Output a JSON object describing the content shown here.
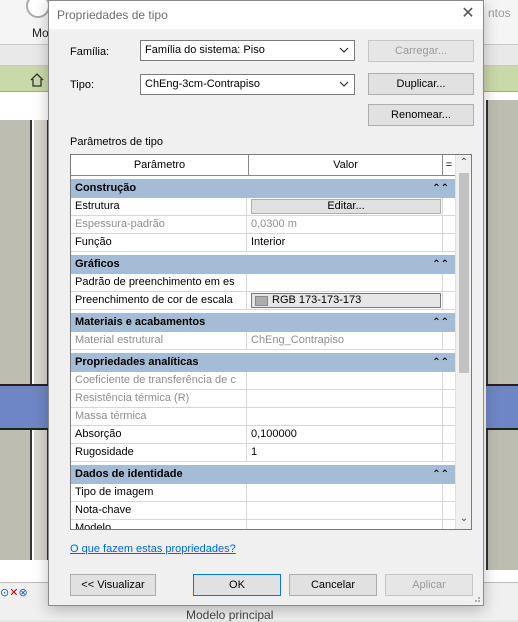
{
  "background": {
    "top_left_label": "Mo",
    "top_right_label": "ntos",
    "view_selector_label": "Modelo principal"
  },
  "dialog": {
    "title": "Propriedades de tipo",
    "family_label": "Família:",
    "family_value": "Família do sistema: Piso",
    "type_label": "Tipo:",
    "type_value": "ChEng-3cm-Contrapiso",
    "load_button": "Carregar...",
    "duplicate_button": "Duplicar...",
    "rename_button": "Renomear...",
    "params_section_title": "Parâmetros de tipo",
    "table": {
      "col_param": "Parâmetro",
      "col_value": "Valor",
      "col_eq": "="
    },
    "groups": {
      "construcao": "Construção",
      "graficos": "Gráficos",
      "materiais": "Materiais e acabamentos",
      "analiticas": "Propriedades analíticas",
      "identidade": "Dados de identidade"
    },
    "rows": {
      "estrutura": {
        "param": "Estrutura",
        "value": "Editar..."
      },
      "espessura": {
        "param": "Espessura-padrão",
        "value": "0,0300 m"
      },
      "funcao": {
        "param": "Função",
        "value": "Interior"
      },
      "padrao": {
        "param": "Padrão de preenchimento em es",
        "value": ""
      },
      "preench_cor": {
        "param": "Preenchimento de cor de escala",
        "value": "RGB 173-173-173"
      },
      "material": {
        "param": "Material estrutural",
        "value": "ChEng_Contrapiso"
      },
      "coef": {
        "param": "Coeficiente de transferência de c",
        "value": ""
      },
      "resistencia": {
        "param": "Resistência térmica (R)",
        "value": ""
      },
      "massa": {
        "param": "Massa térmica",
        "value": ""
      },
      "absorcao": {
        "param": "Absorção",
        "value": "0,100000"
      },
      "rugosidade": {
        "param": "Rugosidade",
        "value": "1"
      },
      "tipo_imagem": {
        "param": "Tipo de imagem",
        "value": ""
      },
      "nota_chave": {
        "param": "Nota-chave",
        "value": ""
      },
      "modelo": {
        "param": "Modelo",
        "value": ""
      }
    },
    "help_link": "O que fazem estas propriedades?",
    "preview_button": "<< Visualizar",
    "ok_button": "OK",
    "cancel_button": "Cancelar",
    "apply_button": "Aplicar"
  },
  "colors": {
    "group_header": "#a5bcd6",
    "link": "#0066cc",
    "swatch": "#adadad"
  }
}
